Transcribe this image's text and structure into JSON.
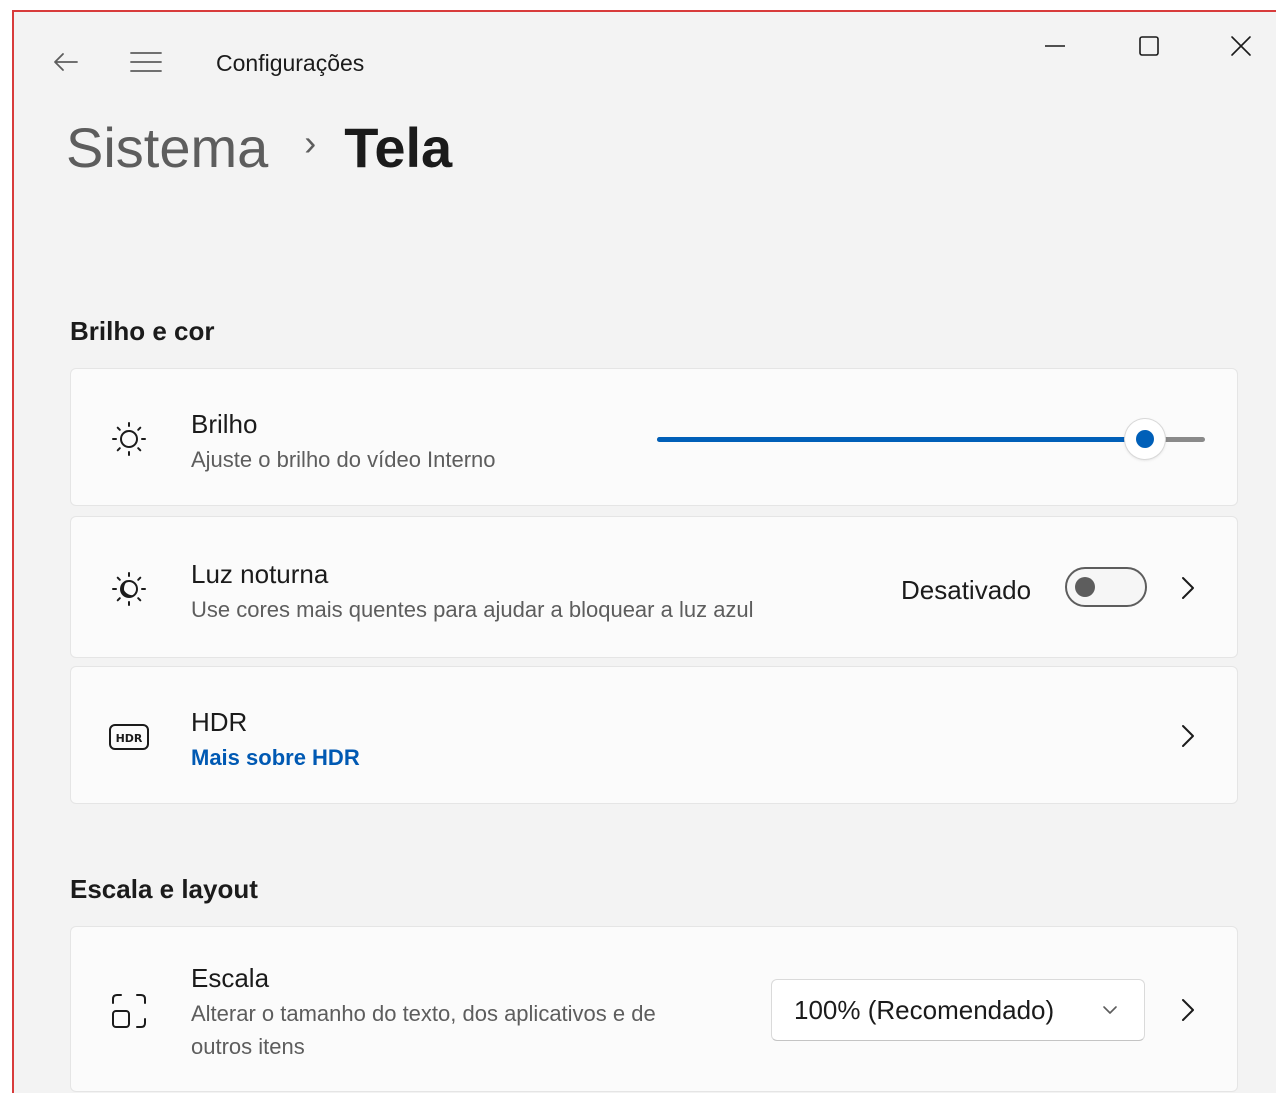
{
  "window": {
    "app_title": "Configurações"
  },
  "breadcrumb": {
    "parent": "Sistema",
    "separator": "›",
    "current": "Tela"
  },
  "sections": {
    "brightness_color": {
      "title": "Brilho e cor",
      "brightness": {
        "icon": "brightness-sun-icon",
        "title": "Brilho",
        "subtitle": "Ajuste o brilho do vídeo Interno",
        "slider_value_fraction": 0.89
      },
      "night_light": {
        "icon": "night-light-icon",
        "title": "Luz noturna",
        "subtitle": "Use cores mais quentes para ajudar a bloquear a luz azul",
        "status": "Desativado",
        "toggle_on": false
      },
      "hdr": {
        "icon": "hdr-icon",
        "title": "HDR",
        "link": "Mais sobre HDR"
      }
    },
    "scale_layout": {
      "title": "Escala e layout",
      "scale": {
        "icon": "scale-icon",
        "title": "Escala",
        "subtitle_line1": "Alterar o tamanho do texto, dos aplicativos e de",
        "subtitle_line2": "outros itens",
        "dropdown_value": "100% (Recomendado)"
      }
    }
  },
  "colors": {
    "accent": "#005fb8",
    "link": "#0059b3",
    "window_bg": "#f3f3f3",
    "card_bg": "#fbfbfb",
    "border_highlight": "#d83b3b"
  }
}
